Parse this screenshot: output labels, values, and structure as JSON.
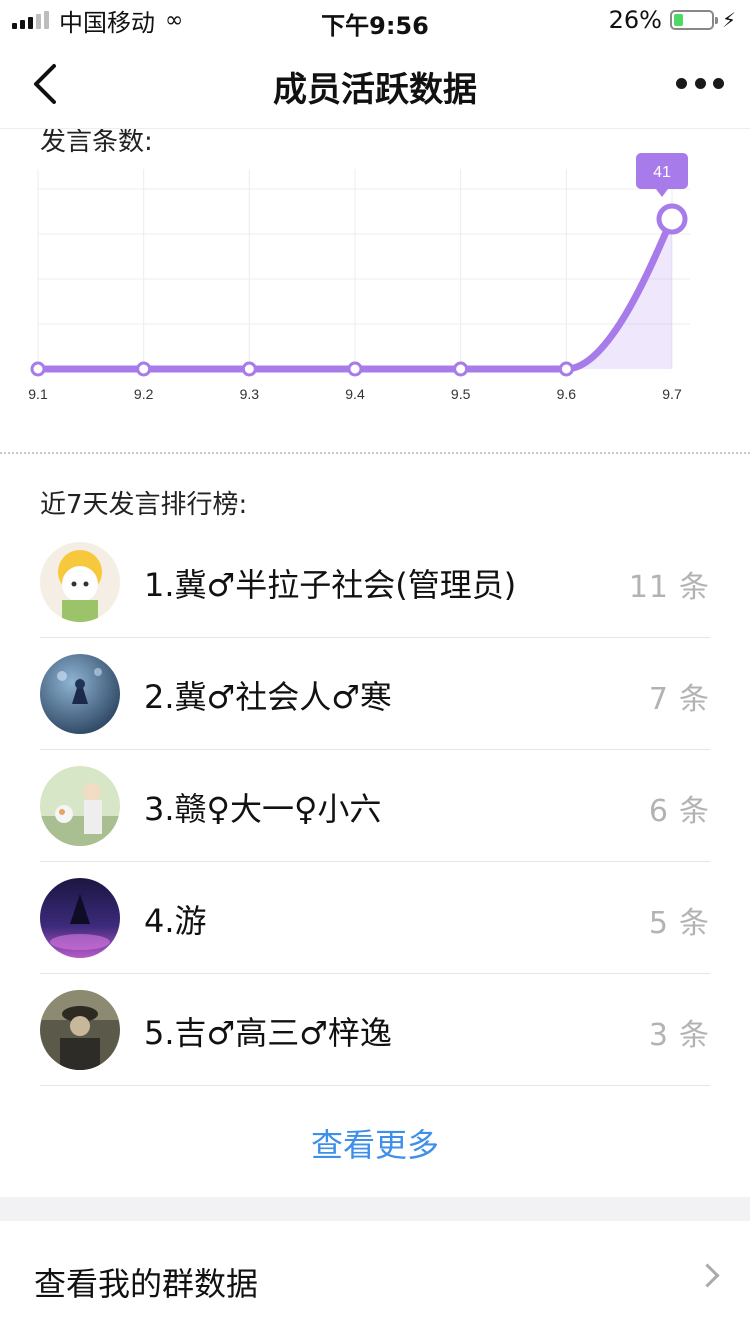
{
  "status_bar": {
    "carrier": "中国移动",
    "time": "下午9:56",
    "battery": "26%",
    "battery_level": 0.26
  },
  "nav": {
    "title": "成员活跃数据",
    "back_icon": "chevron-left-icon",
    "more_icon": "more-dots-icon"
  },
  "chart": {
    "label": "发言条数:",
    "accent": "#a77be9"
  },
  "chart_data": {
    "type": "line",
    "x": [
      "9.1",
      "9.2",
      "9.3",
      "9.4",
      "9.5",
      "9.6",
      "9.7"
    ],
    "series": [
      {
        "values": [
          0,
          0,
          0,
          0,
          0,
          0,
          41
        ]
      }
    ],
    "data_labels": [
      "41"
    ],
    "grid": true,
    "area_fill": true
  },
  "ranking": {
    "title": "近7天发言排行榜:",
    "unit": "条",
    "items": [
      {
        "name": "1.冀♂半拉子社会(管理员)",
        "count": "11"
      },
      {
        "name": "2.冀♂社会人♂寒",
        "count": "7"
      },
      {
        "name": "3.赣♀大一♀小六",
        "count": "6"
      },
      {
        "name": "4.游",
        "count": "5"
      },
      {
        "name": "5.吉♂高三♂梓逸",
        "count": "3"
      }
    ]
  },
  "view_more": "查看更多",
  "my_data": {
    "label": "查看我的群数据",
    "chevron_icon": "chevron-right-icon"
  },
  "colors": {
    "link": "#3d8fea",
    "count": "#b3b3b3",
    "accent": "#a77be9"
  }
}
